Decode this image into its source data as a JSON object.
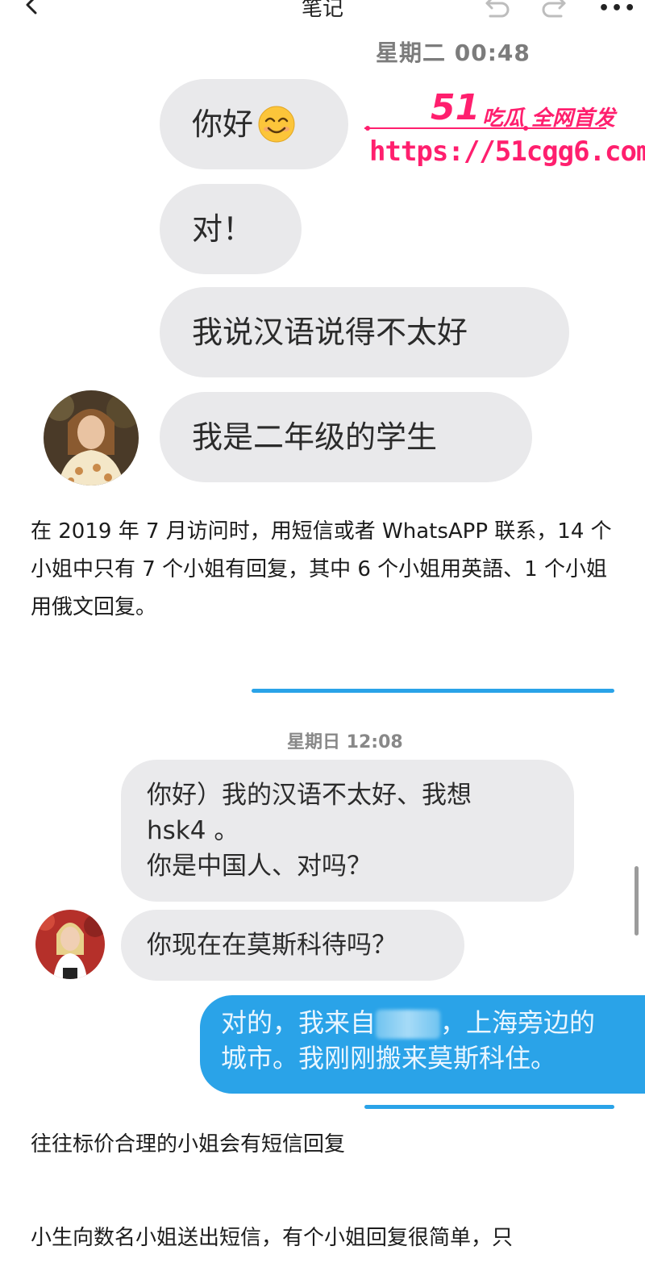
{
  "header": {
    "title": "笔记",
    "more": "•••"
  },
  "chat1": {
    "timestamp": "星期二 00:48",
    "messages": [
      "你好",
      "对！",
      "我说汉语说得不太好",
      "我是二年级的学生"
    ]
  },
  "watermark": {
    "number": "51",
    "brand": "吃瓜 全网首发",
    "url": "https://51cgg6.com"
  },
  "paragraph1": "在 2019 年 7 月访问时，用短信或者 WhatsAPP 联系，14 个小姐中只有 7 个小姐有回复，其中 6 个小姐用英語、1 个小姐用俄文回复。",
  "chat2": {
    "timestamp": "星期日 12:08",
    "incoming1_lines": [
      "你好）我的汉语不太好、我想",
      "hsk4 。",
      "你是中国人、对吗？"
    ],
    "incoming2": "你现在在莫斯科待吗？",
    "outgoing_line1_start": "对的，我来自",
    "outgoing_line1_end": "，上海旁边的",
    "outgoing_line2": "城市。我刚刚搬来莫斯科住。"
  },
  "paragraph2": "往往标价合理的小姐会有短信回复",
  "paragraph3": "小生向数名小姐送出短信，有个小姐回复很简单，只",
  "colors": {
    "incoming_bubble": "#e9e9eb",
    "outgoing_bubble": "#2aa3e8",
    "watermark": "#ff1f6e"
  }
}
